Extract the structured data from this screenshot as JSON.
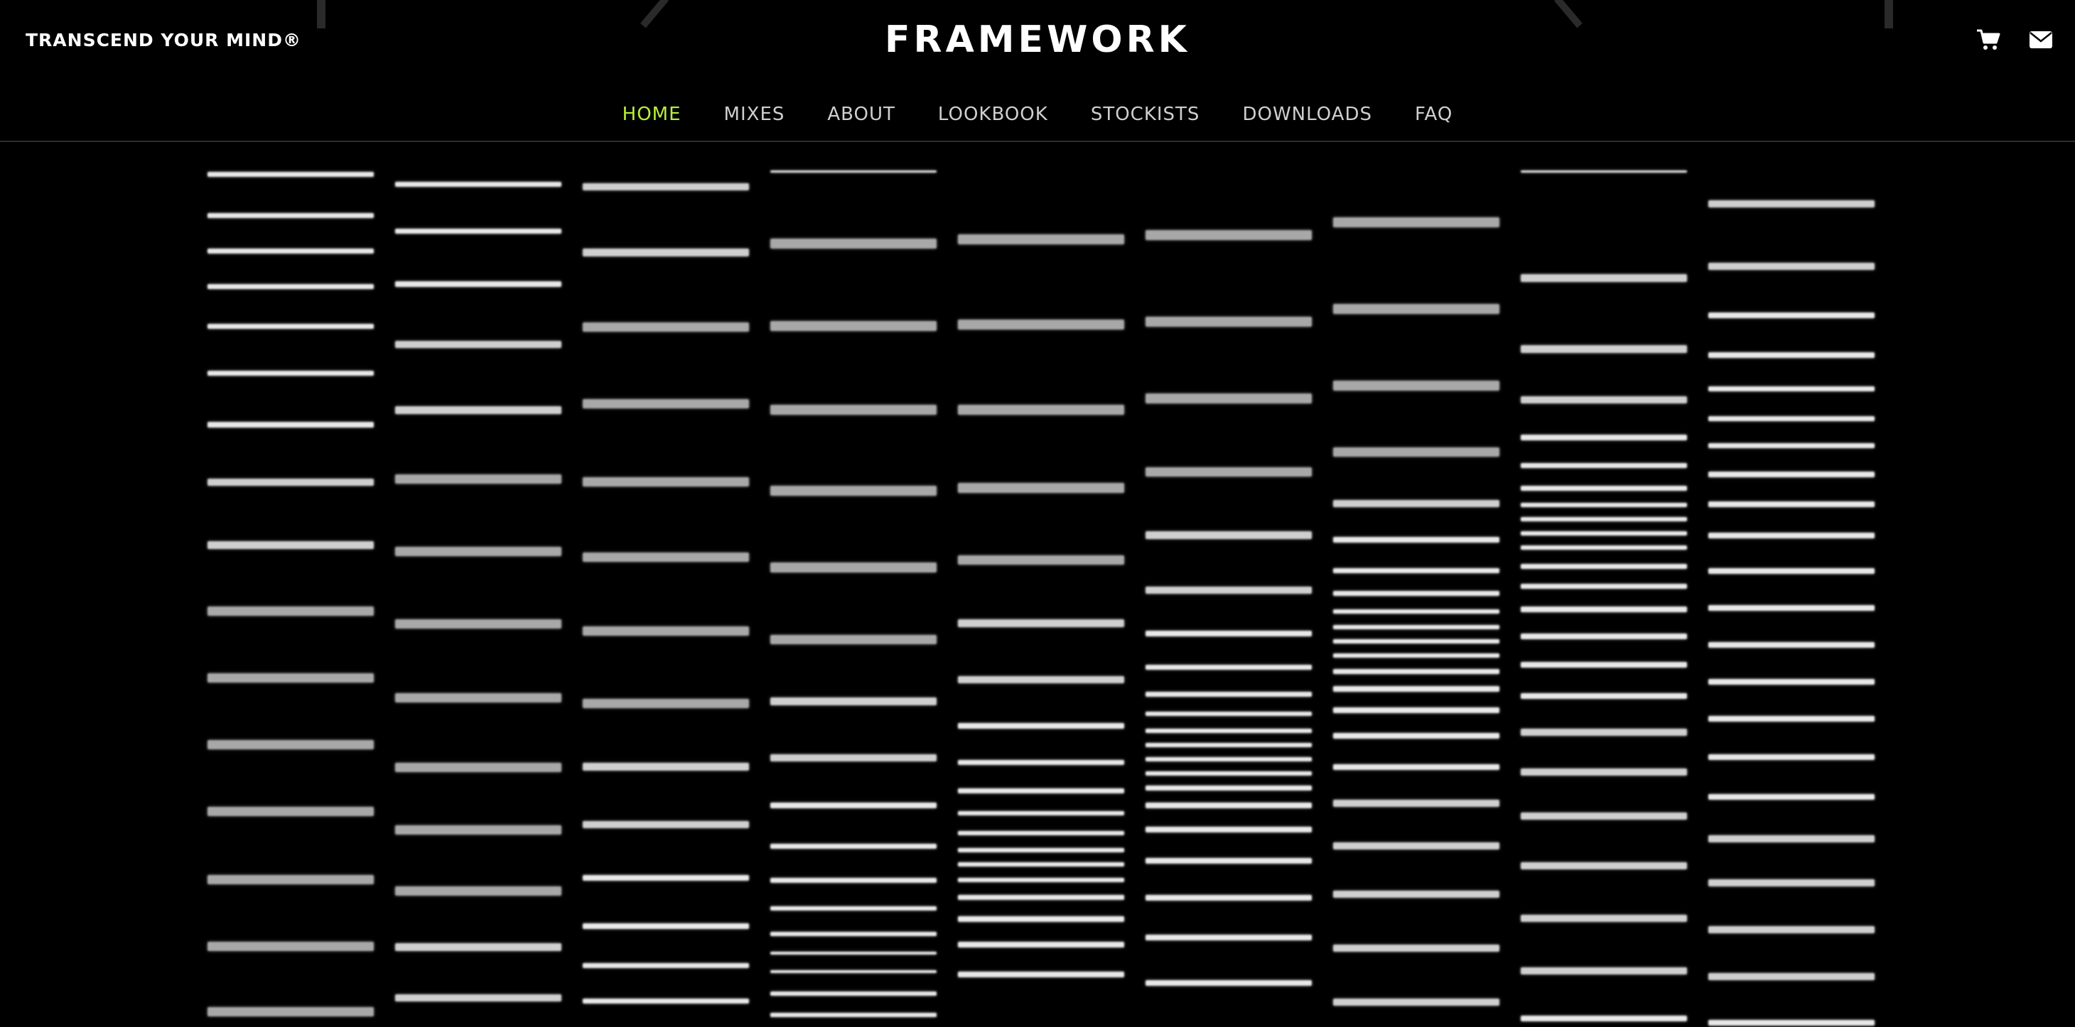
{
  "header": {
    "tagline": "TRANSCEND YOUR MIND®",
    "logo": "FRAMEWORK",
    "icons": [
      "cart-icon",
      "envelope-icon"
    ]
  },
  "nav": {
    "items": [
      {
        "label": "HOME",
        "active": true
      },
      {
        "label": "MIXES",
        "active": false
      },
      {
        "label": "ABOUT",
        "active": false
      },
      {
        "label": "LOOKBOOK",
        "active": false
      },
      {
        "label": "STOCKISTS",
        "active": false
      },
      {
        "label": "DOWNLOADS",
        "active": false
      },
      {
        "label": "FAQ",
        "active": false
      }
    ]
  },
  "colors": {
    "background": "#000000",
    "active_nav": "#b8f03c",
    "nav_text": "#cfcfcf",
    "stripe": "#e8e8e8"
  }
}
